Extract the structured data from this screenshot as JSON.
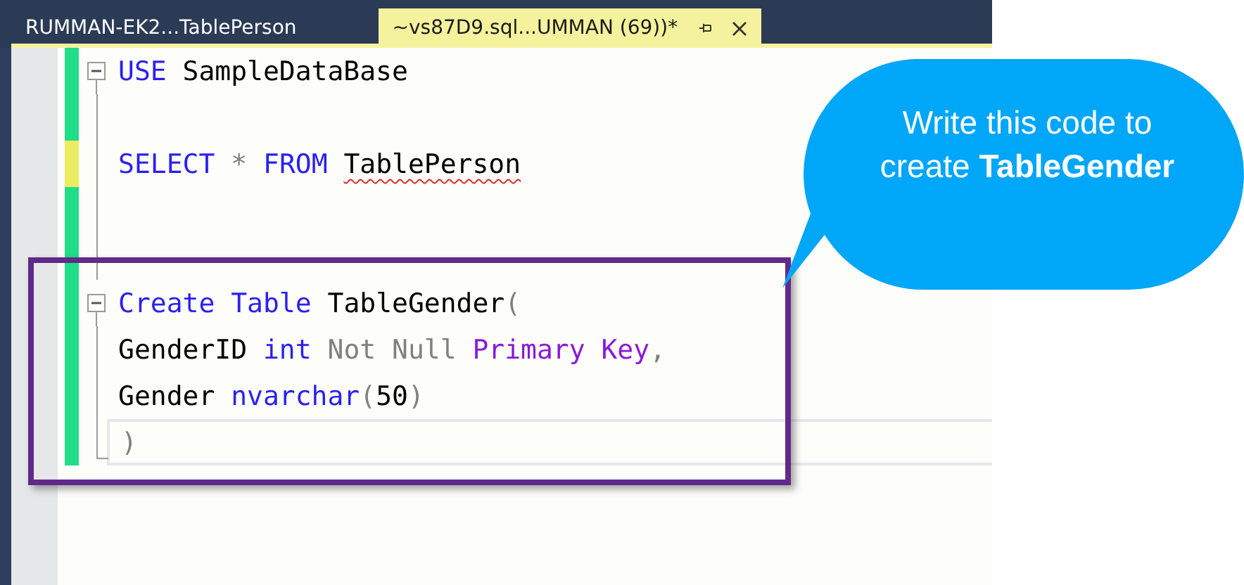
{
  "tabs": [
    {
      "label": "RUMMAN-EK2...TablePerson",
      "selected": false,
      "pinnable": false
    },
    {
      "label": "~vs87D9.sql...UMMAN (69))*",
      "selected": true,
      "pinnable": true
    }
  ],
  "editor": {
    "lines": [
      {
        "saved": true,
        "kind": "fold-start",
        "current": false,
        "tokens": [
          {
            "kind": "keyword",
            "text": "USE"
          },
          {
            "kind": "plain",
            "text": "SampleDataBase"
          }
        ]
      },
      {
        "saved": true,
        "kind": "fold-body",
        "current": false
      },
      {
        "saved": false,
        "kind": "fold-body",
        "current": false,
        "tokens": [
          {
            "kind": "keyword",
            "text": "SELECT"
          },
          {
            "kind": "operator",
            "text": "*"
          },
          {
            "kind": "keyword",
            "text": "FROM"
          },
          {
            "kind": "plain",
            "text": "TablePerson",
            "error": true
          }
        ]
      },
      {
        "saved": true,
        "kind": "fold-body",
        "current": false
      },
      {
        "saved": true,
        "kind": "fold-body",
        "current": false
      },
      {
        "saved": true,
        "kind": "fold-start",
        "current": false,
        "tokens": [
          {
            "kind": "keyword",
            "text": "Create"
          },
          {
            "kind": "keyword",
            "text": "Table"
          },
          {
            "kind": "plain",
            "text": "TableGender"
          },
          {
            "kind": "operator",
            "text": "(",
            "attached": true
          }
        ]
      },
      {
        "saved": true,
        "kind": "fold-body",
        "current": false,
        "tokens": [
          {
            "kind": "plain",
            "text": "GenderID"
          },
          {
            "kind": "keyword",
            "text": "int"
          },
          {
            "kind": "operator",
            "text": "Not Null"
          },
          {
            "kind": "function",
            "text": "Primary Key"
          },
          {
            "kind": "operator",
            "text": ",",
            "attached": true
          }
        ]
      },
      {
        "saved": true,
        "kind": "fold-body",
        "current": false,
        "tokens": [
          {
            "kind": "plain",
            "text": "Gender"
          },
          {
            "kind": "keyword",
            "text": "nvarchar"
          },
          {
            "kind": "operator",
            "text": "(",
            "attached": true
          },
          {
            "kind": "plain",
            "text": "50",
            "attached": true
          },
          {
            "kind": "operator",
            "text": ")",
            "attached": true
          }
        ]
      },
      {
        "saved": true,
        "kind": "fold-end",
        "current": true,
        "tokens": [
          {
            "kind": "operator",
            "text": ")"
          }
        ]
      }
    ]
  },
  "callout": {
    "text": "Write this code to create **TableGender**"
  }
}
